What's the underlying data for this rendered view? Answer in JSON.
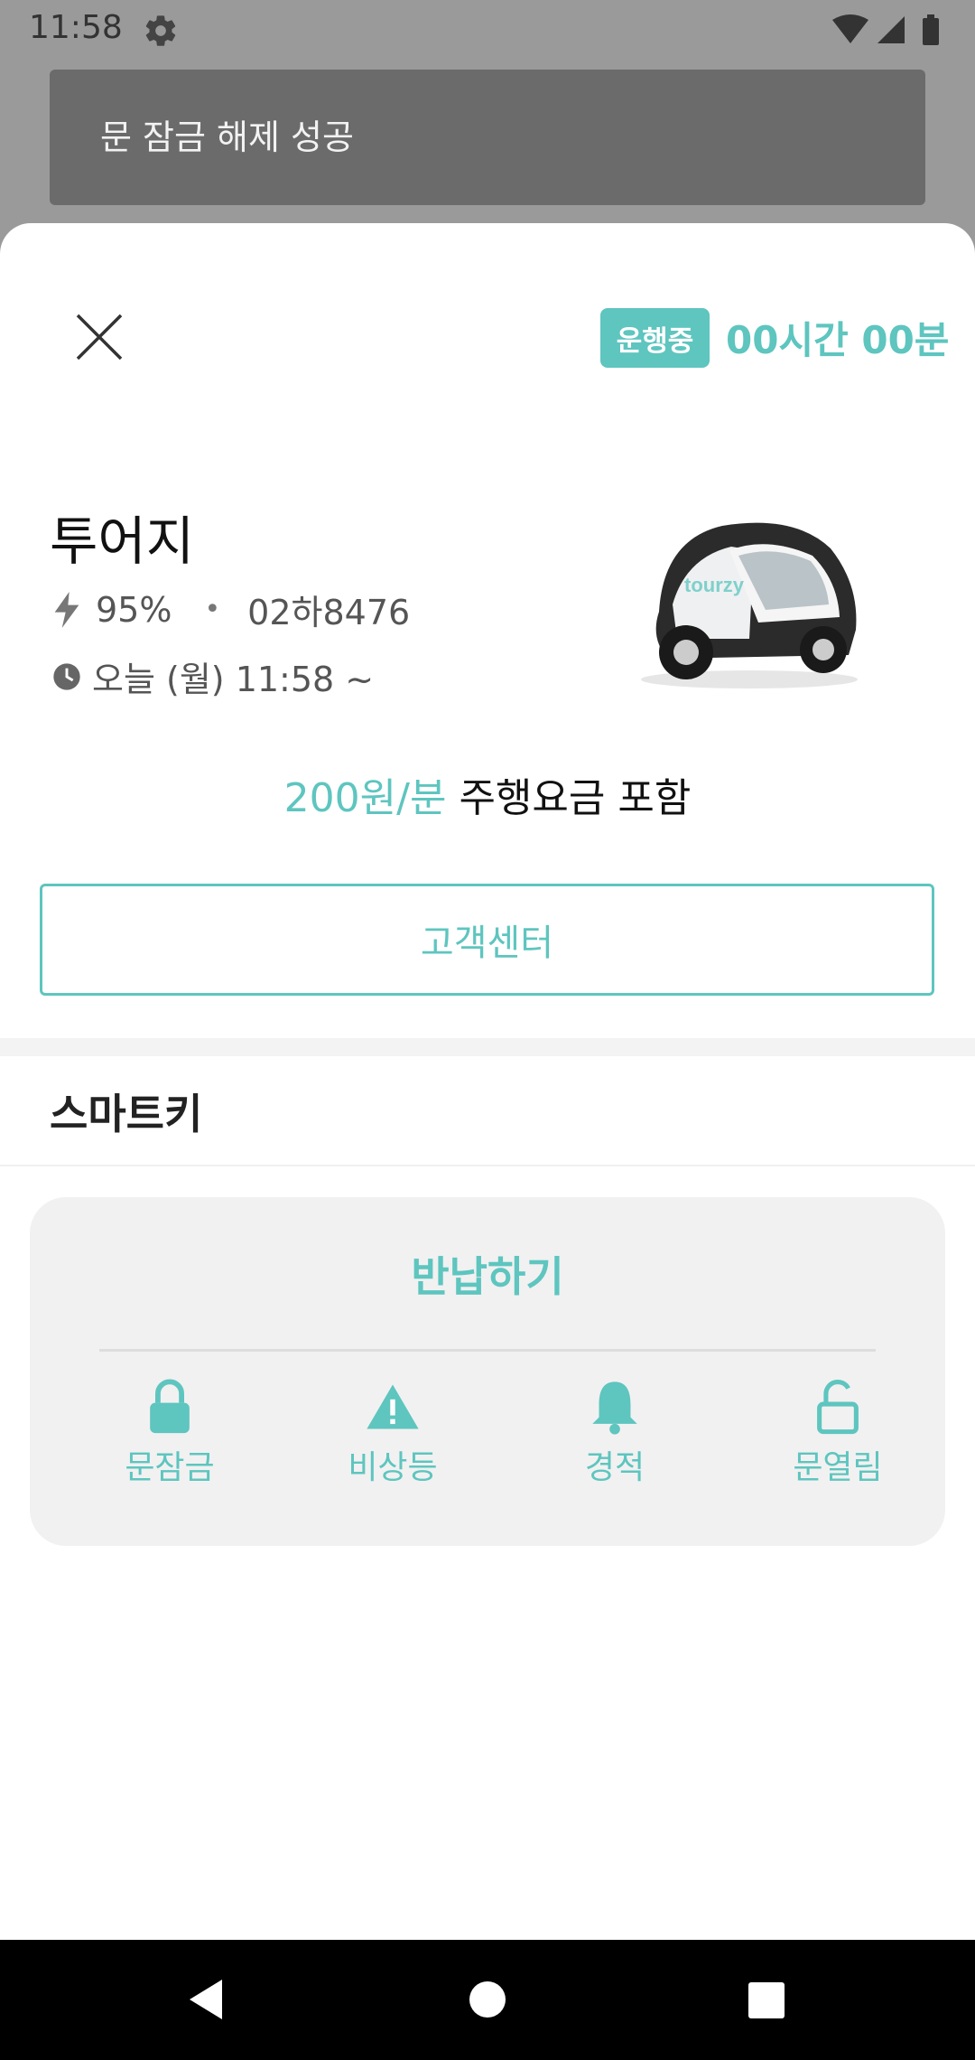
{
  "status_bar": {
    "time": "11:58"
  },
  "toast": {
    "message": "문 잠금 해제 성공"
  },
  "header": {
    "badge": "운행중",
    "elapsed": "00시간 00분"
  },
  "car": {
    "name": "투어지",
    "battery": "95%",
    "plate": "02하8476",
    "start_time": "오늘 (월) 11:58 ~",
    "logo_text": "tourzy"
  },
  "pricing": {
    "rate": "200원/분",
    "note": "주행요금 포함"
  },
  "customer_center": {
    "label": "고객센터"
  },
  "smartkey": {
    "title": "스마트키",
    "return_label": "반납하기",
    "actions": [
      {
        "label": "문잠금",
        "icon": "lock-icon"
      },
      {
        "label": "비상등",
        "icon": "warning-icon"
      },
      {
        "label": "경적",
        "icon": "bell-icon"
      },
      {
        "label": "문열림",
        "icon": "unlock-icon"
      }
    ]
  },
  "colors": {
    "accent": "#5ec5bf",
    "toast_bg": "#6b6b6b",
    "panel_bg": "#f1f1f1"
  }
}
